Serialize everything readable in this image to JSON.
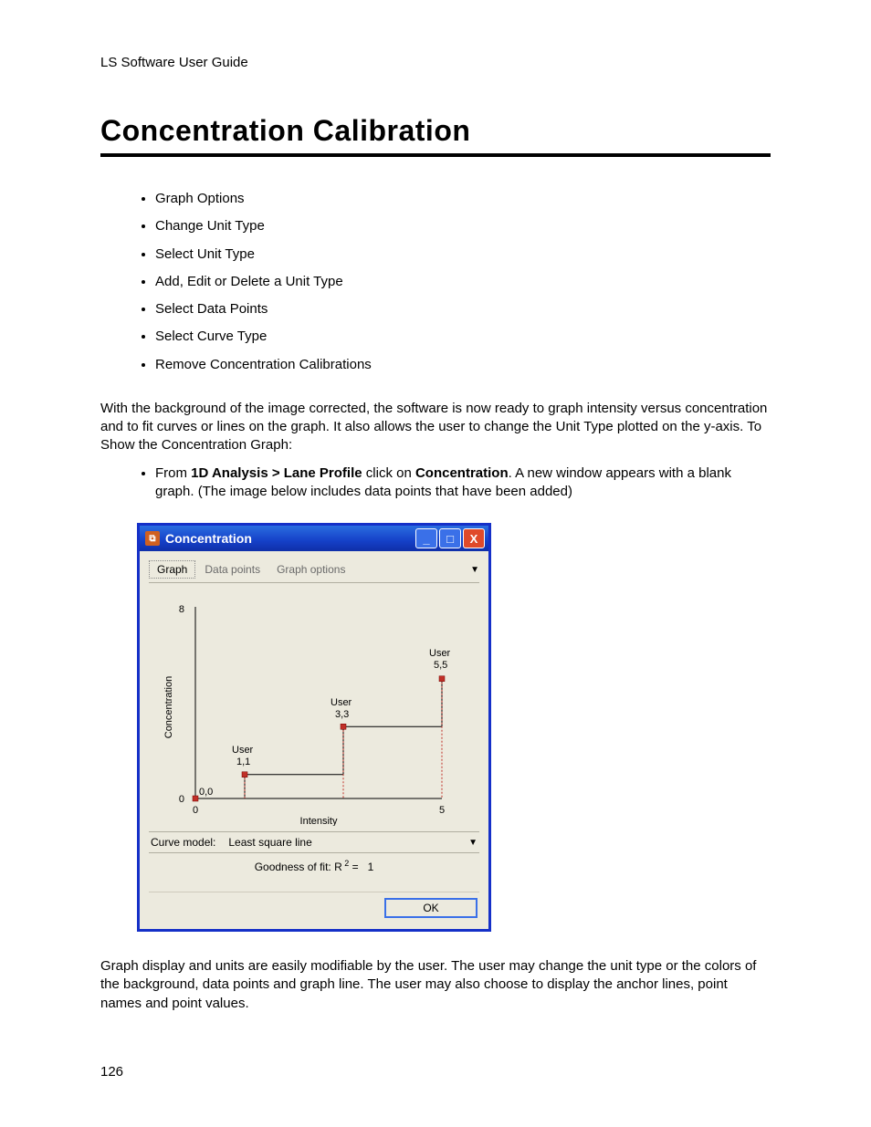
{
  "doc": {
    "running_head": "LS Software User Guide",
    "title": "Concentration Calibration",
    "bullets": [
      "Graph Options",
      "Change Unit Type",
      "Select Unit Type",
      "Add, Edit or Delete a Unit Type",
      "Select Data Points",
      "Select Curve Type",
      "Remove Concentration Calibrations"
    ],
    "para1": "With the background of the image corrected, the software is now ready to graph intensity versus concentration and to fit curves or lines on the graph. It also allows the user to change the Unit Type plotted on the y-axis. To Show the Concentration Graph:",
    "instruct_prefix": "From ",
    "instruct_bold1": "1D Analysis > Lane Profile",
    "instruct_mid": " click on ",
    "instruct_bold2": "Concentration",
    "instruct_suffix": ". A new window appears with a blank graph. (The image below includes data points that have been added)",
    "para2": "Graph display and units are easily modifiable by the user. The user may change the unit type or the colors of the background, data points and graph line. The user may also choose to display the anchor lines, point names and point values.",
    "page_number": "126"
  },
  "win": {
    "title": "Concentration",
    "tabs": [
      "Graph",
      "Data points",
      "Graph options"
    ],
    "active_tab": 0,
    "curve_model_label": "Curve model:",
    "curve_model_value": "Least square line",
    "gof_label": "Goodness of fit: R",
    "gof_eq": " =",
    "gof_value": "1",
    "ok_label": "OK"
  },
  "chart_data": {
    "type": "scatter",
    "title": "",
    "xlabel": "Intensity",
    "ylabel": "Concentration",
    "xlim": [
      0,
      5
    ],
    "ylim": [
      0,
      8
    ],
    "x_ticks": [
      "0",
      "5"
    ],
    "y_ticks": [
      "0",
      "8"
    ],
    "origin_label": "0,0",
    "series": [
      {
        "name": "User",
        "values": [
          {
            "x": 1,
            "y": 1,
            "label_name": "User",
            "label_val": "1,1"
          },
          {
            "x": 3,
            "y": 3,
            "label_name": "User",
            "label_val": "3,3"
          },
          {
            "x": 5,
            "y": 5,
            "label_name": "User",
            "label_val": "5,5"
          }
        ]
      }
    ],
    "step_line": true
  }
}
